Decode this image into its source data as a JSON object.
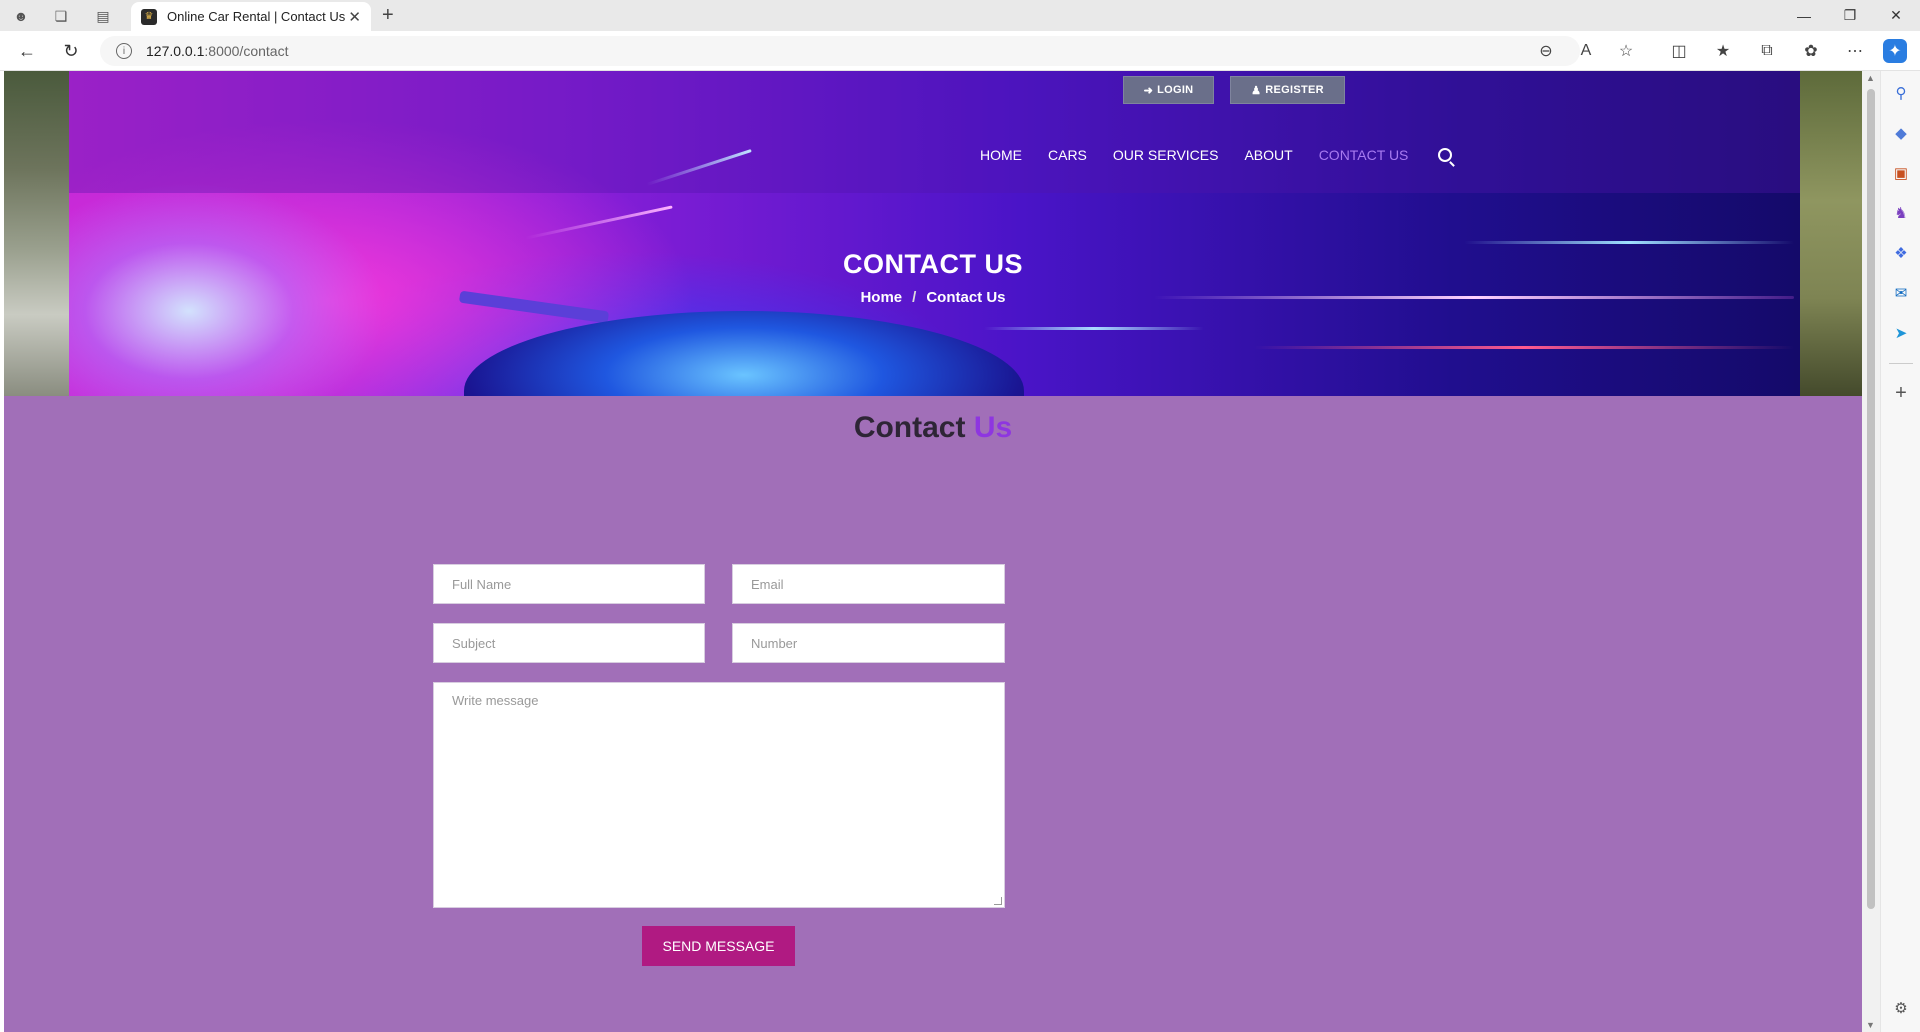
{
  "browser": {
    "tab_title": "Online Car Rental | Contact Us",
    "url_host": "127.0.0.1",
    "url_path": ":8000/contact"
  },
  "header": {
    "login_label": "LOGIN",
    "register_label": "REGISTER",
    "nav": [
      {
        "label": "HOME"
      },
      {
        "label": "CARS"
      },
      {
        "label": "OUR SERVICES"
      },
      {
        "label": "ABOUT"
      },
      {
        "label": "CONTACT US",
        "active": true
      }
    ]
  },
  "hero": {
    "title": "CONTACT US",
    "breadcrumb": {
      "home": "Home",
      "separator": "/",
      "current": "Contact Us"
    }
  },
  "contact": {
    "title_part1": "Contact",
    "title_part2": "Us",
    "form": {
      "full_name_placeholder": "Full Name",
      "email_placeholder": "Email",
      "subject_placeholder": "Subject",
      "number_placeholder": "Number",
      "message_placeholder": "Write message",
      "submit_label": "SEND MESSAGE"
    }
  },
  "colors": {
    "page_background": "#a16fb8",
    "accent_purple": "#8e36e0",
    "button_magenta": "#b01a82",
    "active_nav": "#a77af0"
  }
}
